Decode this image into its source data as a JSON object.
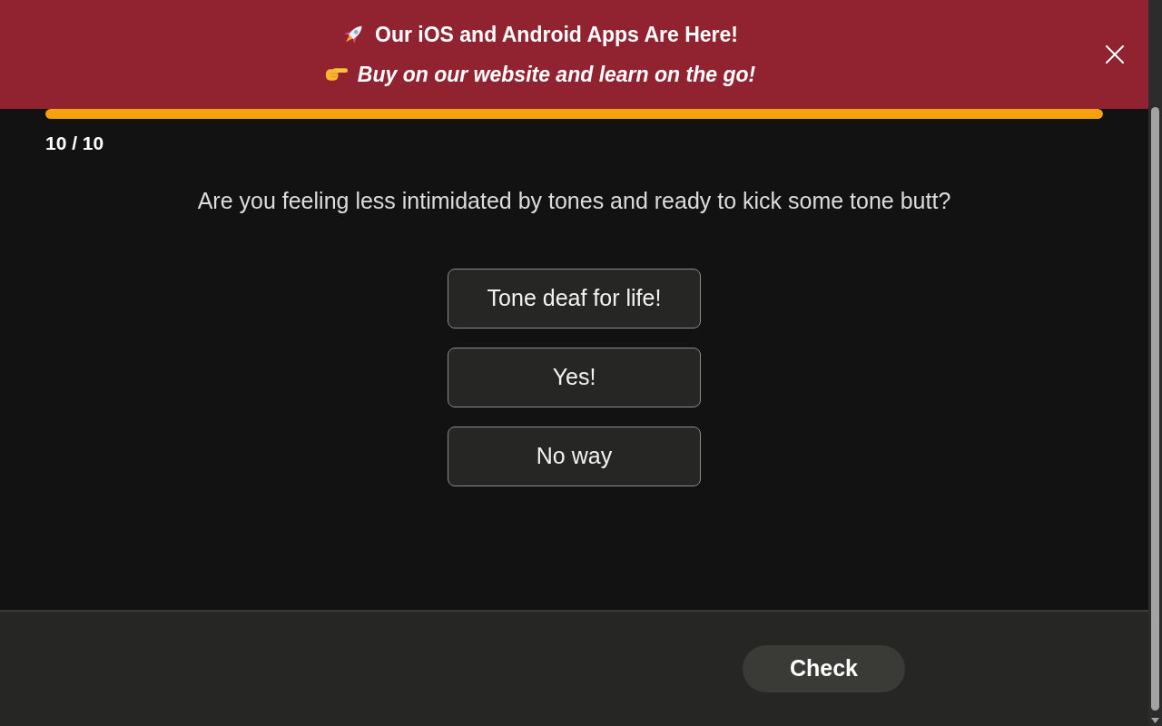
{
  "banner": {
    "headline": "Our iOS and Android Apps Are Here!",
    "subline": "Buy on our website and learn on the go!"
  },
  "progress": {
    "level": 1.0,
    "counter": "10 / 10"
  },
  "question": "Are you feeling less intimidated by tones and ready to kick some tone butt?",
  "options": [
    {
      "label": "Tone deaf for life!",
      "selected": false
    },
    {
      "label": "Yes!",
      "selected": false
    },
    {
      "label": "No way",
      "selected": false
    }
  ],
  "check_button": {
    "label": "Check",
    "disabled": true
  }
}
